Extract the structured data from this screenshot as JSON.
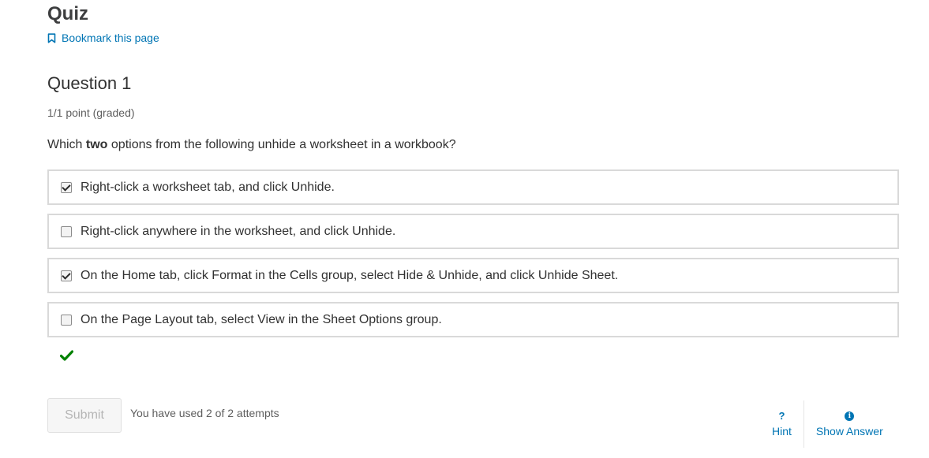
{
  "page": {
    "title": "Quiz",
    "bookmark_label": "Bookmark this page"
  },
  "question": {
    "title": "Question 1",
    "points": "1/1 point (graded)",
    "prompt_before": "Which ",
    "prompt_bold": "two",
    "prompt_after": " options from the following unhide a worksheet in a workbook?",
    "options": [
      {
        "label": "Right-click a worksheet tab, and click Unhide.",
        "checked": true
      },
      {
        "label": "Right-click anywhere in the worksheet, and click Unhide.",
        "checked": false
      },
      {
        "label": "On the Home tab, click Format in the Cells group, select Hide & Unhide, and click Unhide Sheet.",
        "checked": true
      },
      {
        "label": "On the Page Layout tab, select View in the Sheet Options group.",
        "checked": false
      }
    ],
    "result": "correct"
  },
  "footer": {
    "submit_label": "Submit",
    "attempts_text": "You have used 2 of 2 attempts",
    "hint_glyph": "?",
    "hint_label": "Hint",
    "show_answer_label": "Show Answer"
  },
  "colors": {
    "link": "#0075b4",
    "correct": "#008100",
    "option_border": "#d9d9d9"
  }
}
